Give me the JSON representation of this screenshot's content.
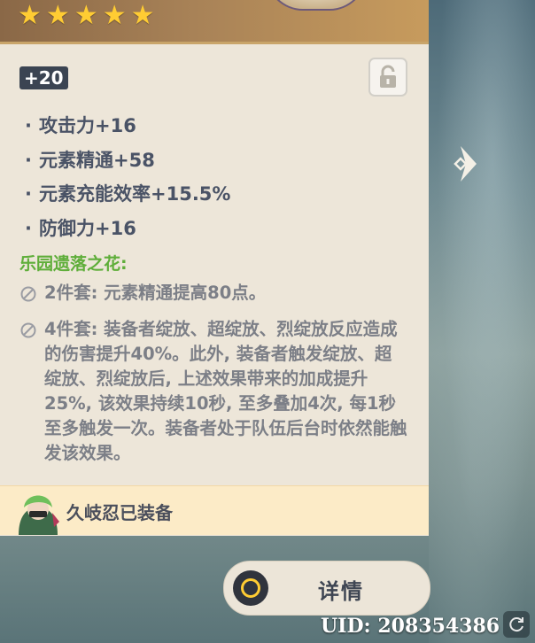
{
  "artifact": {
    "rarity_stars": 5,
    "level": "+20",
    "lock_icon": "lock-open-icon"
  },
  "stats": [
    "攻击力+16",
    "元素精通+58",
    "元素充能效率+15.5%",
    "防御力+16"
  ],
  "set": {
    "name": "乐园遗落之花:",
    "effects": [
      "2件套: 元素精通提高80点。",
      "4件套: 装备者绽放、超绽放、烈绽放反应造成的伤害提升40%。此外, 装备者触发绽放、超绽放、烈绽放后, 上述效果带来的加成提升25%, 该效果持续10秒, 至多叠加4次, 每1秒至多触发一次。装备者处于队伍后台时依然能触发该效果。"
    ]
  },
  "equipped": {
    "label": "久岐忍已装备"
  },
  "details_button": {
    "label": "详情"
  },
  "uid": "UID: 208354386",
  "colors": {
    "set_name": "#5fae3a",
    "star": "#ffcc33",
    "panel": "#ede6d9"
  }
}
